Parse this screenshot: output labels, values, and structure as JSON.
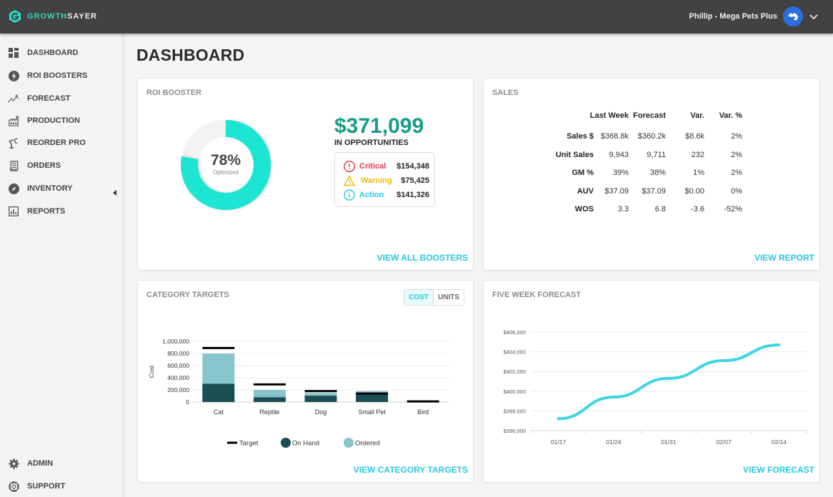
{
  "app": {
    "brand_part1": "GROWTH",
    "brand_part2": "SAYER",
    "user_label": "Phillip - Mega Pets Plus"
  },
  "sidebar": {
    "items": [
      {
        "label": "DASHBOARD",
        "icon": "dashboard-icon"
      },
      {
        "label": "ROI BOOSTERS",
        "icon": "bolt-icon"
      },
      {
        "label": "FORECAST",
        "icon": "trend-icon"
      },
      {
        "label": "PRODUCTION",
        "icon": "factory-icon"
      },
      {
        "label": "REORDER PRO",
        "icon": "robot-arm-icon"
      },
      {
        "label": "ORDERS",
        "icon": "receipt-icon"
      },
      {
        "label": "INVENTORY",
        "icon": "compass-icon"
      },
      {
        "label": "REPORTS",
        "icon": "bar-report-icon"
      }
    ],
    "bottom_items": [
      {
        "label": "ADMIN",
        "icon": "gear-icon"
      },
      {
        "label": "SUPPORT",
        "icon": "lifebuoy-icon"
      }
    ]
  },
  "page": {
    "title": "DASHBOARD"
  },
  "roi": {
    "title": "ROI BOOSTER",
    "optimized_pct": 78,
    "optimized_label": "78%",
    "optimized_sub": "Optimized",
    "total": "$371,099",
    "total_sub": "IN OPPORTUNITIES",
    "rows": [
      {
        "label": "Critical",
        "value": "$154,348",
        "color": "#e03a4e"
      },
      {
        "label": "Warning",
        "value": "$75,425",
        "color": "#f5b800"
      },
      {
        "label": "Action",
        "value": "$141,326",
        "color": "#27c8e0"
      }
    ],
    "link": "VIEW ALL BOOSTERS"
  },
  "sales": {
    "title": "SALES",
    "columns": [
      "Last Week",
      "Forecast",
      "Var.",
      "Var. %"
    ],
    "rows": [
      {
        "label": "Sales $",
        "values": [
          "$368.8k",
          "$360.2k",
          "$8.6k",
          "2%"
        ]
      },
      {
        "label": "Unit Sales",
        "values": [
          "9,943",
          "9,711",
          "232",
          "2%"
        ]
      },
      {
        "label": "GM %",
        "values": [
          "39%",
          "38%",
          "1%",
          "2%"
        ]
      },
      {
        "label": "AUV",
        "values": [
          "$37.09",
          "$37.09",
          "$0.00",
          "0%"
        ]
      },
      {
        "label": "WOS",
        "values": [
          "3.3",
          "6.8",
          "-3.6",
          "-52%"
        ]
      }
    ],
    "link": "VIEW REPORT"
  },
  "category": {
    "title": "CATEGORY TARGETS",
    "toggle": {
      "cost": "COST",
      "units": "UNITS",
      "selected": "COST"
    },
    "link": "VIEW CATEGORY TARGETS"
  },
  "forecast": {
    "title": "FIVE WEEK FORECAST",
    "link": "VIEW FORECAST"
  },
  "chart_data": [
    {
      "type": "bar",
      "title": "",
      "stacked": true,
      "categories": [
        "Cat",
        "Reptile",
        "Dog",
        "Small Pet",
        "Bird"
      ],
      "series": [
        {
          "name": "On Hand",
          "color": "#1b4d54",
          "values": [
            300000,
            80000,
            105000,
            130000,
            0
          ]
        },
        {
          "name": "Ordered",
          "color": "#88c4cb",
          "values": [
            500000,
            120000,
            45000,
            50000,
            0
          ]
        },
        {
          "name": "Target",
          "color": "#000000",
          "kind": "marker",
          "values": [
            890000,
            290000,
            180000,
            140000,
            10000
          ]
        }
      ],
      "xlabel": "",
      "ylabel": "Cost",
      "ylim": [
        0,
        1000000
      ],
      "yticks": [
        0,
        200000,
        400000,
        600000,
        800000,
        1000000
      ],
      "ytick_labels": [
        "0",
        "200,000",
        "400,000",
        "600,000",
        "800,000",
        "1,000,000"
      ],
      "grid": true,
      "legend": [
        "Target",
        "On Hand",
        "Ordered"
      ],
      "legend_position": "bottom"
    },
    {
      "type": "line",
      "title": "",
      "x": [
        "01/17",
        "01/24",
        "01/31",
        "02/07",
        "02/14"
      ],
      "series": [
        {
          "name": "Forecast",
          "color": "#3dd6e0",
          "values": [
            397200,
            399400,
            401300,
            403100,
            404700
          ]
        }
      ],
      "ylim": [
        396000,
        406000
      ],
      "yticks": [
        396000,
        398000,
        400000,
        402000,
        404000,
        406000
      ],
      "ytick_labels": [
        "$396,000",
        "$398,000",
        "$400,000",
        "$402,000",
        "$404,000",
        "$406,000"
      ],
      "grid": true
    }
  ]
}
